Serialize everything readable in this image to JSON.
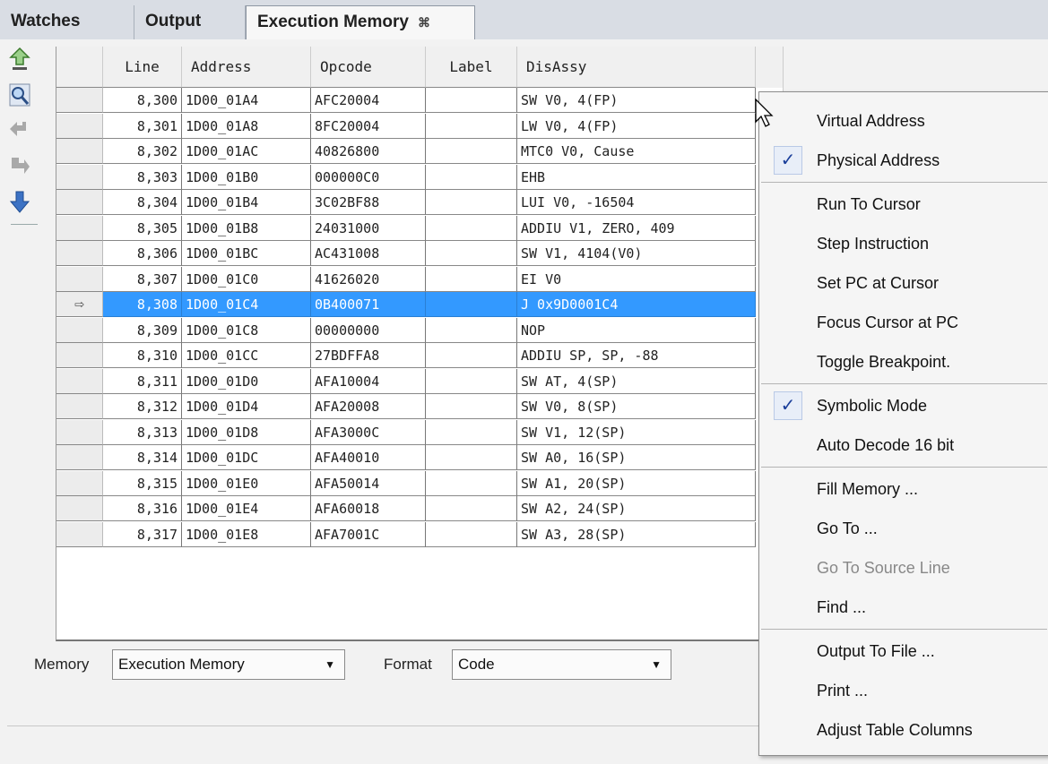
{
  "tabs": [
    {
      "label": "Watches"
    },
    {
      "label": "Output"
    },
    {
      "label": "Execution Memory",
      "close": "⌘"
    }
  ],
  "toolbar": [
    "go-up-icon",
    "search-icon",
    "step-back-icon",
    "step-icon",
    "go-down-icon"
  ],
  "table": {
    "columns": [
      "Line",
      "Address",
      "Opcode",
      "Label",
      "DisAssy"
    ],
    "rows": [
      [
        "8,300",
        "1D00_01A4",
        "AFC20004",
        "",
        "SW V0, 4(FP)"
      ],
      [
        "8,301",
        "1D00_01A8",
        "8FC20004",
        "",
        "LW V0, 4(FP)"
      ],
      [
        "8,302",
        "1D00_01AC",
        "40826800",
        "",
        "MTC0 V0, Cause"
      ],
      [
        "8,303",
        "1D00_01B0",
        "000000C0",
        "",
        "EHB"
      ],
      [
        "8,304",
        "1D00_01B4",
        "3C02BF88",
        "",
        "LUI V0, -16504"
      ],
      [
        "8,305",
        "1D00_01B8",
        "24031000",
        "",
        "ADDIU V1, ZERO, 409"
      ],
      [
        "8,306",
        "1D00_01BC",
        "AC431008",
        "",
        "SW V1, 4104(V0)"
      ],
      [
        "8,307",
        "1D00_01C0",
        "41626020",
        "",
        "EI V0"
      ],
      [
        "8,308",
        "1D00_01C4",
        "0B400071",
        "",
        "J 0x9D0001C4"
      ],
      [
        "8,309",
        "1D00_01C8",
        "00000000",
        "",
        "NOP"
      ],
      [
        "8,310",
        "1D00_01CC",
        "27BDFFA8",
        "",
        "ADDIU SP, SP, -88"
      ],
      [
        "8,311",
        "1D00_01D0",
        "AFA10004",
        "",
        "SW AT, 4(SP)"
      ],
      [
        "8,312",
        "1D00_01D4",
        "AFA20008",
        "",
        "SW V0, 8(SP)"
      ],
      [
        "8,313",
        "1D00_01D8",
        "AFA3000C",
        "",
        "SW V1, 12(SP)"
      ],
      [
        "8,314",
        "1D00_01DC",
        "AFA40010",
        "",
        "SW A0, 16(SP)"
      ],
      [
        "8,315",
        "1D00_01E0",
        "AFA50014",
        "",
        "SW A1, 20(SP)"
      ],
      [
        "8,316",
        "1D00_01E4",
        "AFA60018",
        "",
        "SW A2, 24(SP)"
      ],
      [
        "8,317",
        "1D00_01E8",
        "AFA7001C",
        "",
        "SW A3, 28(SP)"
      ]
    ],
    "current_marker": "⇨",
    "current_line": "8,308"
  },
  "bottom": {
    "memory_label": "Memory",
    "memory_value": "Execution Memory",
    "format_label": "Format",
    "format_value": "Code"
  },
  "context_menu": {
    "items": [
      {
        "label": "Virtual Address",
        "checked": false
      },
      {
        "label": "Physical Address",
        "checked": true
      },
      {
        "separator": true
      },
      {
        "label": "Run To Cursor"
      },
      {
        "label": "Step Instruction"
      },
      {
        "label": "Set PC at Cursor"
      },
      {
        "label": "Focus Cursor at PC"
      },
      {
        "label": "Toggle Breakpoint."
      },
      {
        "separator": true
      },
      {
        "label": "Symbolic Mode",
        "checked": true
      },
      {
        "label": "Auto Decode 16 bit"
      },
      {
        "separator": true
      },
      {
        "label": "Fill Memory ..."
      },
      {
        "label": "Go To ..."
      },
      {
        "label": "Go To Source Line",
        "disabled": true
      },
      {
        "label": "Find ..."
      },
      {
        "separator": true
      },
      {
        "label": "Output To File ..."
      },
      {
        "label": "Print ..."
      },
      {
        "label": "Adjust Table Columns"
      }
    ],
    "check_glyph": "✓"
  }
}
